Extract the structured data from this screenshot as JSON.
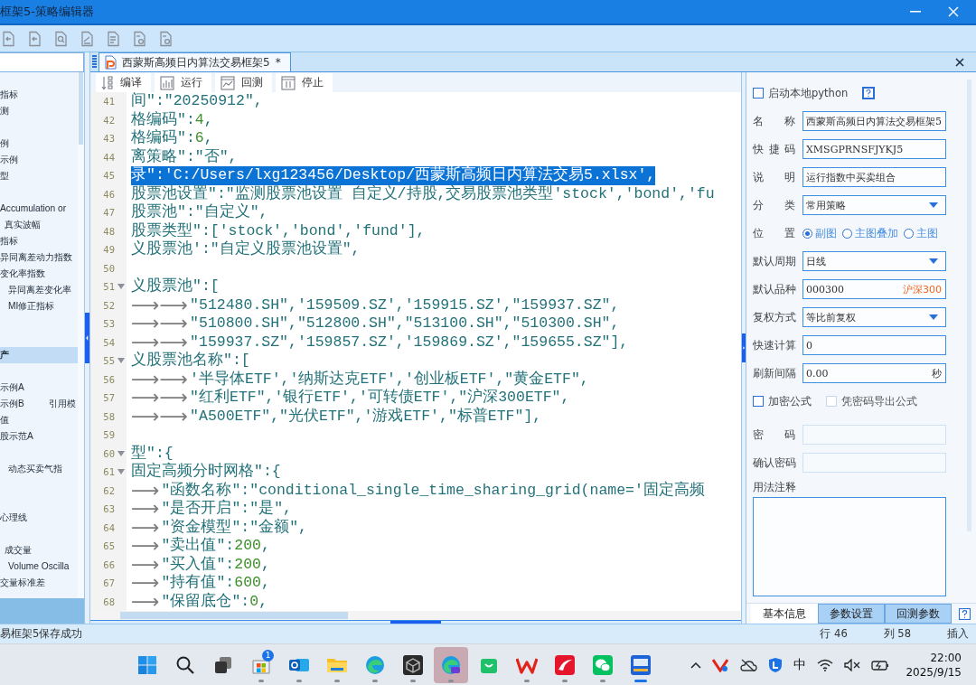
{
  "window": {
    "title": "框架5-策略编辑器"
  },
  "sidebar": {
    "items": [
      {
        "kind": "item",
        "label": "指标",
        "selected": false
      },
      {
        "kind": "item",
        "label": "测",
        "selected": false
      },
      {
        "kind": "spacer"
      },
      {
        "kind": "item",
        "label": "例",
        "selected": false
      },
      {
        "kind": "item",
        "label": "示例",
        "selected": false
      },
      {
        "kind": "item",
        "label": "型",
        "selected": false
      },
      {
        "kind": "spacer"
      },
      {
        "kind": "item",
        "label": "Accumulation or",
        "selected": false
      },
      {
        "kind": "sub",
        "label": "真实波幅",
        "selected": false
      },
      {
        "kind": "item",
        "label": "指标",
        "selected": false
      },
      {
        "kind": "item",
        "label": "异同离差动力指数",
        "selected": false
      },
      {
        "kind": "item",
        "label": "变化率指数",
        "selected": false
      },
      {
        "kind": "deep",
        "label": "异同离差变化率",
        "selected": false
      },
      {
        "kind": "deep",
        "label": "MI修正指标",
        "selected": false
      },
      {
        "kind": "spacer"
      },
      {
        "kind": "spacer"
      },
      {
        "kind": "item",
        "label": "产",
        "selected": true
      },
      {
        "kind": "spacer"
      },
      {
        "kind": "item",
        "label": "示例A",
        "selected": false
      },
      {
        "kind": "item",
        "label": "示例B",
        "trailing": "引用模",
        "selected": false
      },
      {
        "kind": "item",
        "label": "值",
        "selected": false
      },
      {
        "kind": "item",
        "label": "股示范A",
        "selected": false
      },
      {
        "kind": "spacer"
      },
      {
        "kind": "deep",
        "label": "动态买卖气指",
        "selected": false
      },
      {
        "kind": "spacer"
      },
      {
        "kind": "spacer"
      },
      {
        "kind": "item",
        "label": "心理线",
        "selected": false
      },
      {
        "kind": "spacer"
      },
      {
        "kind": "sub",
        "label": "成交量",
        "selected": false
      },
      {
        "kind": "deep",
        "label": "Volume Oscilla",
        "selected": false
      },
      {
        "kind": "item",
        "label": "交量标准差",
        "selected": false
      }
    ]
  },
  "editor": {
    "tab": {
      "label": "西蒙斯高频日内算法交易框架5",
      "marker": "*"
    },
    "actions": [
      {
        "kind": "compile",
        "label": "编译"
      },
      {
        "kind": "run",
        "label": "运行"
      },
      {
        "kind": "backtest",
        "label": "回测"
      },
      {
        "kind": "stop",
        "label": "停止"
      }
    ],
    "lines": [
      {
        "number": "41",
        "text": "间\":\"20250912\",",
        "foldable": false,
        "selected": false
      },
      {
        "number": "42",
        "text": "格编码\":4,",
        "foldable": false,
        "selected": false
      },
      {
        "number": "43",
        "text": "格编码\":6,",
        "foldable": false,
        "selected": false
      },
      {
        "number": "44",
        "text": "离策略\":\"否\",",
        "foldable": false,
        "selected": false
      },
      {
        "number": "45",
        "text": "录\":'C:/Users/lxg123456/Desktop/西蒙斯高频日内算法交易5.xlsx',",
        "foldable": false,
        "selected": true
      },
      {
        "number": "46",
        "text": "股票池设置\":\"监测股票池设置 自定义/持股,交易股票池类型'stock','bond','fu",
        "foldable": false,
        "selected": false
      },
      {
        "number": "47",
        "text": "股票池\":\"自定义\",",
        "foldable": false,
        "selected": false
      },
      {
        "number": "48",
        "text": "股票类型\":['stock','bond','fund'],",
        "foldable": false,
        "selected": false
      },
      {
        "number": "49",
        "text": "义股票池':\"自定义股票池设置\",",
        "foldable": false,
        "selected": false
      },
      {
        "number": "50",
        "foldable": false,
        "selected": false
      },
      {
        "number": "51",
        "text": "义股票池\":[",
        "foldable": true,
        "selected": false
      },
      {
        "number": "52",
        "tabs": "⟶⟶",
        "text": "\"512480.SH\",'159509.SZ','159915.SZ',\"159937.SZ\",",
        "foldable": false,
        "selected": false
      },
      {
        "number": "53",
        "tabs": "⟶⟶",
        "text": "\"510800.SH\",\"512800.SH\",\"513100.SH\",\"510300.SH\",",
        "foldable": false,
        "selected": false
      },
      {
        "number": "54",
        "tabs": "⟶⟶",
        "text": "\"159937.SZ\",'159857.SZ','159869.SZ',\"159655.SZ\"],",
        "foldable": false,
        "selected": false
      },
      {
        "number": "55",
        "text": "义股票池名称\":[",
        "foldable": true,
        "selected": false
      },
      {
        "number": "56",
        "tabs": "⟶⟶",
        "text": "'半导体ETF','纳斯达克ETF','创业板ETF',\"黄金ETF\",",
        "foldable": false,
        "selected": false
      },
      {
        "number": "57",
        "tabs": "⟶⟶",
        "text": "\"红利ETF\",'银行ETF','可转债ETF',\"沪深300ETF\",",
        "foldable": false,
        "selected": false
      },
      {
        "number": "58",
        "tabs": "⟶⟶",
        "text": "\"A500ETF\",\"光伏ETF\",'游戏ETF',\"标普ETF\"],",
        "foldable": false,
        "selected": false
      },
      {
        "number": "59",
        "foldable": false,
        "selected": false
      },
      {
        "number": "60",
        "text": "型\":{",
        "foldable": true,
        "selected": false
      },
      {
        "number": "61",
        "text": "固定高频分时网格\":{",
        "foldable": true,
        "selected": false
      },
      {
        "number": "62",
        "tabs": "⟶",
        "text": "\"函数名称\":\"conditional_single_time_sharing_grid(name='固定高频",
        "foldable": false,
        "selected": false
      },
      {
        "number": "63",
        "tabs": "⟶",
        "text": "\"是否开启\":\"是\",",
        "foldable": false,
        "selected": false
      },
      {
        "number": "64",
        "tabs": "⟶",
        "text": "\"资金模型\":\"金额\",",
        "foldable": false,
        "selected": false
      },
      {
        "number": "65",
        "tabs": "⟶",
        "text": "\"卖出值\":200,",
        "foldable": false,
        "selected": false
      },
      {
        "number": "66",
        "tabs": "⟶",
        "text": "\"买入值\":200,",
        "foldable": false,
        "selected": false
      },
      {
        "number": "67",
        "tabs": "⟶",
        "text": "\"持有值\":600,",
        "foldable": false,
        "selected": false
      },
      {
        "number": "68",
        "tabs": "⟶",
        "text": "\"保留底仓\":0,",
        "foldable": false,
        "selected": false
      }
    ]
  },
  "properties": {
    "fields": [
      {
        "kind": "checkbox",
        "help": true,
        "options": [
          {
            "label": "启动本地python",
            "checked": false,
            "disabled": false
          }
        ]
      },
      {
        "kind": "text",
        "label": "名称",
        "value": "西蒙斯高频日内算法交易框架5"
      },
      {
        "kind": "text",
        "label": "快捷码",
        "value": "XMSGPRNSFJYKJ5"
      },
      {
        "kind": "text",
        "label": "说明",
        "value": "运行指数中买卖组合"
      },
      {
        "kind": "select",
        "label": "分类",
        "value": "常用策略"
      },
      {
        "kind": "radio",
        "label": "位置",
        "options": [
          {
            "label": "副图",
            "selected": true
          },
          {
            "label": "主图叠加",
            "selected": false
          },
          {
            "label": "主图",
            "selected": false
          }
        ]
      },
      {
        "kind": "select",
        "label": "默认周期",
        "value": "日线"
      },
      {
        "kind": "text",
        "label": "默认品种",
        "value": "000300",
        "suffix": "沪深300"
      },
      {
        "kind": "select",
        "label": "复权方式",
        "value": "等比前复权"
      },
      {
        "kind": "text",
        "label": "快速计算",
        "value": "0"
      },
      {
        "kind": "text",
        "label": "刷新间隔",
        "value": "0.00",
        "unit": "秒"
      },
      {
        "kind": "checkbox",
        "help": false,
        "options": [
          {
            "label": "加密公式",
            "checked": false,
            "disabled": false
          },
          {
            "label": "凭密码导出公式",
            "checked": false,
            "disabled": true
          }
        ]
      },
      {
        "kind": "password",
        "label": "密码",
        "disabled": true
      },
      {
        "kind": "password",
        "label": "确认密码",
        "disabled": true
      },
      {
        "kind": "notes",
        "label": "用法注释"
      }
    ],
    "tabs": [
      {
        "label": "基本信息",
        "selected": true
      },
      {
        "label": "参数设置",
        "selected": false
      },
      {
        "label": "回测参数",
        "selected": false
      }
    ]
  },
  "status_bar": {
    "message": "易框架5保存成功",
    "line": "行 46",
    "column": "列 58",
    "mode": "插入"
  },
  "taskbar": {
    "apps": [
      {
        "kind": "start",
        "running": false,
        "highlighted": false
      },
      {
        "kind": "search",
        "running": false,
        "highlighted": false
      },
      {
        "kind": "taskview",
        "running": false,
        "highlighted": false
      },
      {
        "kind": "store",
        "badge": "1",
        "running": true,
        "highlighted": false
      },
      {
        "kind": "mail",
        "running": true,
        "highlighted": false
      },
      {
        "kind": "folder",
        "running": true,
        "highlighted": false
      },
      {
        "kind": "browser",
        "running": true,
        "highlighted": false
      },
      {
        "kind": "cube",
        "running": true,
        "highlighted": false
      },
      {
        "kind": "browser-ai",
        "running": true,
        "highlighted": true
      },
      {
        "kind": "greenbag",
        "running": false,
        "highlighted": false
      },
      {
        "kind": "wlogo",
        "running": true,
        "highlighted": false
      },
      {
        "kind": "redapp",
        "running": true,
        "highlighted": false
      },
      {
        "kind": "chat",
        "running": true,
        "highlighted": false
      },
      {
        "kind": "blueapp",
        "running": true,
        "highlighted": false,
        "focused": true
      }
    ],
    "tray": {
      "ime": "中",
      "time": "22:00",
      "date": "2025/9/15"
    }
  }
}
